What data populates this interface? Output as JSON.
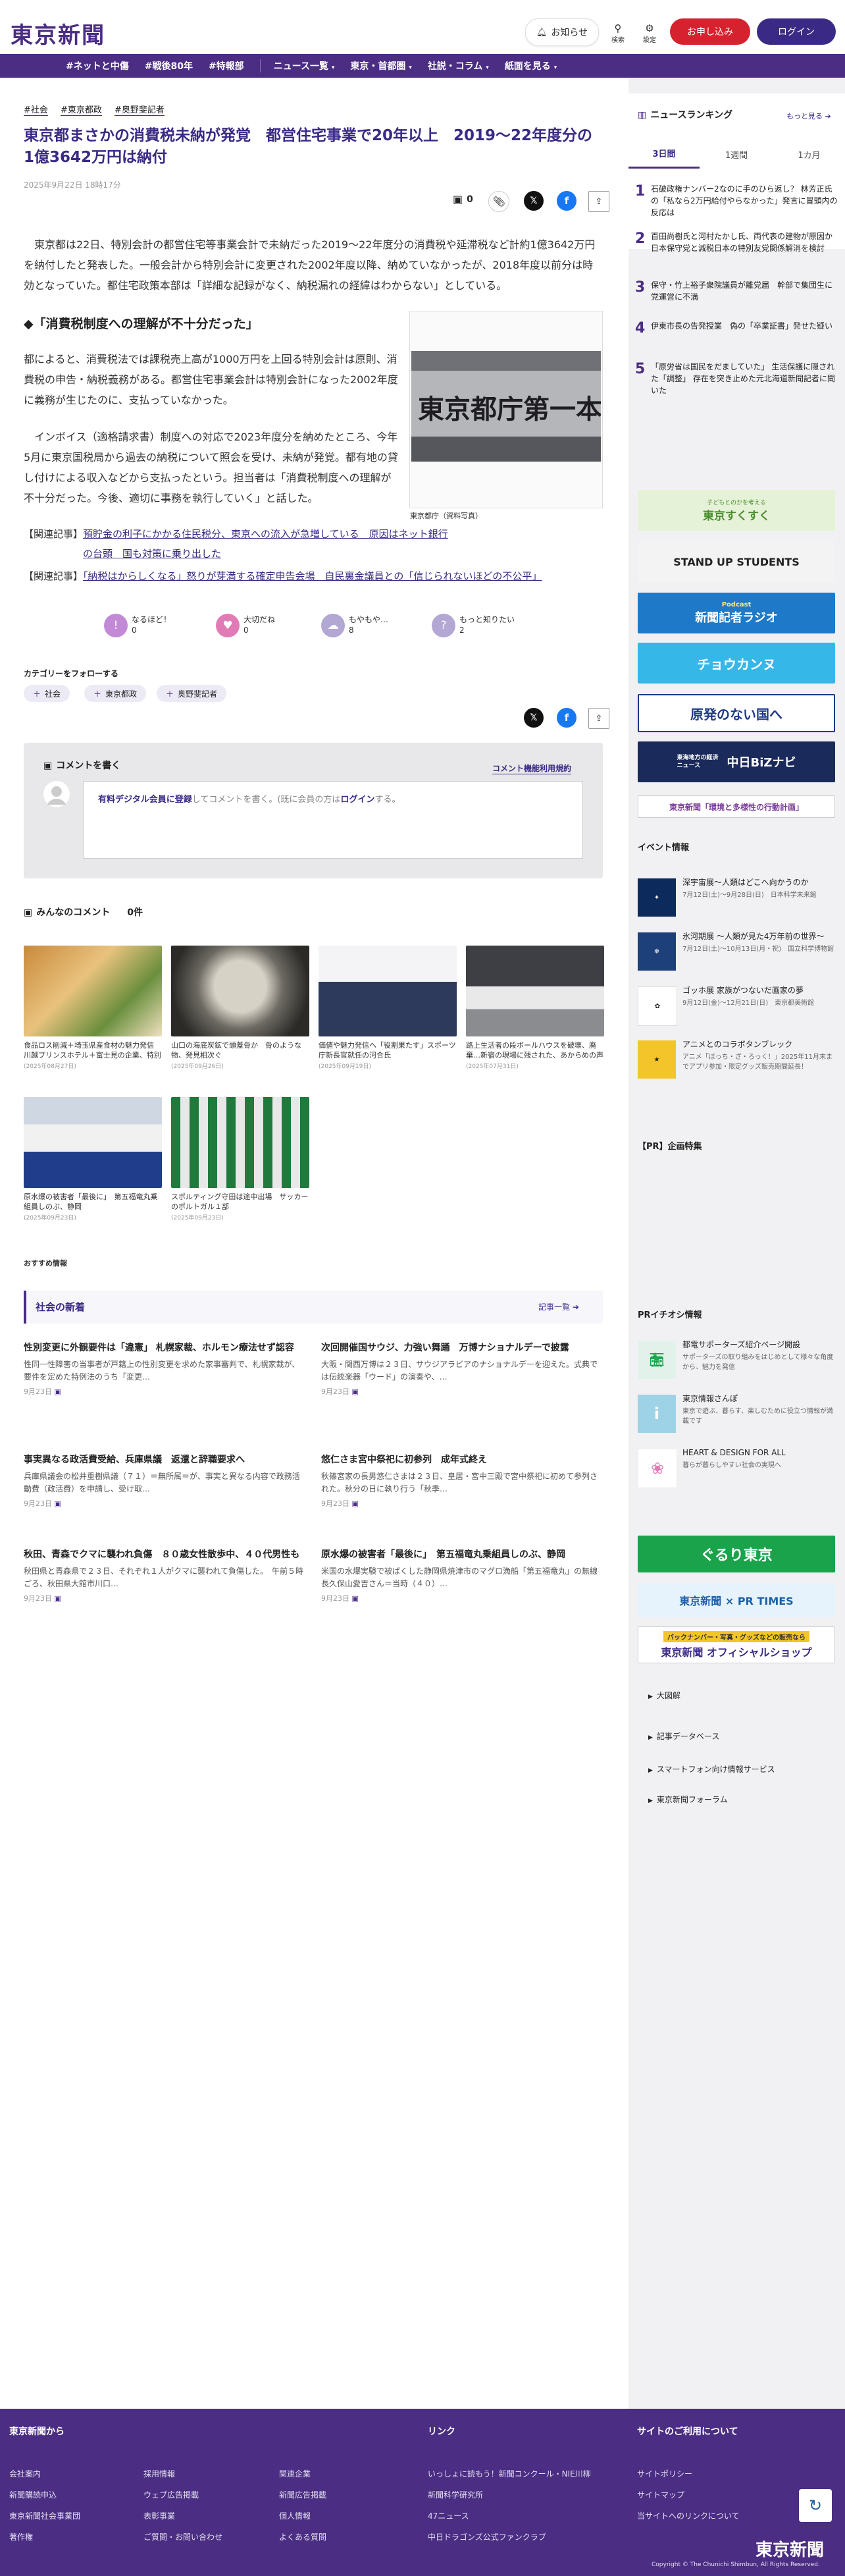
{
  "header": {
    "logo": "東京新聞",
    "notice_label": "お知らせ",
    "search_label": "検索",
    "settings_label": "設定",
    "subscribe_label": "お申し込み",
    "login_label": "ログイン"
  },
  "nav": {
    "items": [
      "#ネットと中傷",
      "#戦後80年",
      "#特報部",
      "ニュース一覧",
      "東京・首都圏",
      "社説・コラム",
      "紙面を見る"
    ]
  },
  "article": {
    "tags": [
      "#社会",
      "#東京都政",
      "#奥野斐記者"
    ],
    "title": "東京都まさかの消費税未納が発覚　都営住宅事業で20年以上　2019～22年度分の1億3642万円は納付",
    "date": "2025年9月22日 18時17分",
    "comment_count": "0",
    "lead": "東京都は22日、特別会計の都営住宅等事業会計で未納だった2019～22年度分の消費税や延滞税など計約1億3642万円を納付したと発表した。一般会計から特別会計に変更された2002年度以降、納めていなかったが、2018年度以前分は時効となっていた。都住宅政策本部は「詳細な記録がなく、納税漏れの経緯はわからない」としている。",
    "heading": "◆「消費税制度への理解が不十分だった」",
    "p1": "都によると、消費税法では課税売上高が1000万円を上回る特別会計は原則、消費税の申告・納税義務がある。都営住宅事業会計は特別会計になった2002年度に義務が生じたのに、支払っていなかった。",
    "p2": "インボイス（適格請求書）制度への対応で2023年度分を納めたところ、今年5月に東京国税局から過去の納税について照会を受け、未納が発覚。都有地の貸し付けによる収入などから支払ったという。担当者は「消費税制度への理解が不十分だった。今後、適切に事務を執行していく」と話した。",
    "photo_caption": "東京都庁（資料写真）",
    "photo_sign": "東京都庁第一本庁舎",
    "related_label": "【関連記事】",
    "related1": "預貯金の利子にかかる住民税分、東京への流入が急増している　原因はネット銀行の台頭　国も対策に乗り出した",
    "related2": "「納税はからしくなる」怒りが芽満する確定申告会場　自民裏金議員との「信じられないほどの不公平」",
    "reactions": [
      {
        "label": "なるほど！",
        "count": "0",
        "color": "#c28ad6",
        "icon": "lightbulb-icon"
      },
      {
        "label": "大切だね",
        "count": "0",
        "color": "#e07bb5",
        "icon": "heart-icon"
      },
      {
        "label": "もやもや…",
        "count": "8",
        "color": "#b3a7d4",
        "icon": "cloud-icon"
      },
      {
        "label": "もっと知りたい",
        "count": "2",
        "color": "#b3a7d4",
        "icon": "question-icon"
      }
    ],
    "follow_label": "カテゴリーをフォローする",
    "follow_tags": [
      "社会",
      "東京都政",
      "奥野斐記者"
    ]
  },
  "comments": {
    "write_label": "コメントを書く",
    "rules_link": "コメント機能利用規約",
    "prompt_link": "有料デジタル会員に登録",
    "prompt_mid": "してコメントを書く。(既に会員の方は",
    "prompt_login": "ログイン",
    "prompt_end": "する。",
    "all_label": "みんなのコメント",
    "all_count": "0件"
  },
  "thumbs": [
    {
      "caption": "食品ロス削減＋埼玉県産食材の魅力発信　川越プリンスホテル＋富士見の企業、特別メニュー…",
      "date": "(2025年08月27日)"
    },
    {
      "caption": "山口の海底炭鉱で頭蓋骨か　骨のような物、発見相次ぐ",
      "date": "(2025年09月26日)"
    },
    {
      "caption": "価値や魅力発信へ「役割果たす」スポーツ庁新長官就任の河合氏",
      "date": "(2025年09月19日)"
    },
    {
      "caption": "路上生活者の段ボールハウスを破壊、廃棄…新宿の現場に残された、あからめの声と「やり…",
      "date": "(2025年07月31日)"
    },
    {
      "caption": "原水爆の被害者「最後に」　第五福竜丸乗組員しのぶ、静岡",
      "date": "(2025年09月23日)"
    },
    {
      "caption": "スポルティング守田は途中出場　サッカーのポルトガル１部",
      "date": "(2025年09月23日)"
    }
  ],
  "recommend_label": "おすすめ情報",
  "society": {
    "title": "社会の新着",
    "more": "記事一覧",
    "items": [
      {
        "title": "性別変更に外観要件は「違憲」 札幌家裁、ホルモン療法せず認容",
        "summary": "性同一性障害の当事者が戸籍上の性別変更を求めた家事審判で、札幌家裁が、要件を定めた特例法のうち「変更…",
        "date": "9月23日"
      },
      {
        "title": "次回開催国サウジ、力強い舞踊　万博ナショナルデーで披露",
        "summary": "大阪・関西万博は２３日、サウジアラビアのナショナルデーを迎えた。式典では伝統楽器「ウード」の演奏や、…",
        "date": "9月23日"
      },
      {
        "title": "事実異なる政活費受給、兵庫県議　返還と辞職要求へ",
        "summary": "兵庫県議会の松井重樹県議（７１）＝無所属＝が、事実と異なる内容で政務活動費（政活費）を申請し、受け取…",
        "date": "9月23日"
      },
      {
        "title": "悠仁さま宮中祭祀に初参列　成年式終え",
        "summary": "秋篠宮家の長男悠仁さまは２３日、皇居・宮中三殿で宮中祭祀に初めて参列された。秋分の日に執り行う「秋季…",
        "date": "9月23日"
      },
      {
        "title": "秋田、青森でクマに襲われ負傷　８０歳女性散歩中、４０代男性も",
        "summary": "秋田県と青森県で２３日、それぞれ１人がクマに襲われて負傷した。　午前５時ごろ、秋田県大館市川口…",
        "date": "9月23日"
      },
      {
        "title": "原水爆の被害者「最後に」　第五福竜丸乗組員しのぶ、静岡",
        "summary": "米国の水爆実験で被ばくした静岡県焼津市のマグロ漁船「第五福竜丸」の無線長久保山愛吉さん＝当時（４０）…",
        "date": "9月23日"
      }
    ]
  },
  "sidebar": {
    "ranking_title": "ニュースランキング",
    "ranking_more": "もっと見る",
    "tabs": [
      "3日間",
      "1週間",
      "1カ月"
    ],
    "ranking": [
      {
        "num": "1",
        "text": "石破政権ナンバー2なのに手のひら返し？ 林芳正氏の「私なら2万円給付やらなかった」発言に冒頭内の反応は"
      },
      {
        "num": "2",
        "text": "百田尚樹氏と河村たかし氏、両代表の建物が原因か　日本保守党と減税日本の特別友党関係解消を検討"
      },
      {
        "num": "3",
        "text": "保守・竹上裕子衆院議員が離党届　幹部で集団生に党運営に不満"
      },
      {
        "num": "4",
        "text": "伊東市長の告発授業　偽の「卒業証書」発せた疑い"
      },
      {
        "num": "5",
        "text": "「原労省は国民をだましていた」 生活保護に隠された「調整」 存在を突き止めた元北海道新聞記者に聞いた"
      }
    ],
    "banners": [
      {
        "text": "東京すくすく",
        "sub": "子どもとのかを考える",
        "bg": "#e6f2d8",
        "fg": "#4b8f2f"
      },
      {
        "text": "STAND UP STUDENTS",
        "sub": "",
        "bg": "#f3f3f3",
        "fg": "#222"
      },
      {
        "text": "新聞記者ラジオ",
        "sub": "Podcast",
        "bg": "#1e7ac8",
        "fg": "#fff"
      },
      {
        "text": "チョウカンヌ",
        "sub": "",
        "bg": "#35b8e8",
        "fg": "#fff"
      },
      {
        "text": "原発のない国へ",
        "sub": "",
        "bg": "#fff",
        "fg": "#1d3a87"
      },
      {
        "text": "中日BiZナビ",
        "sub": "東海地方の経済ニュース",
        "bg": "#1a2a5a",
        "fg": "#fff"
      },
      {
        "text": "東京新聞「環境と多様性の行動計画」",
        "sub": "",
        "bg": "#fff",
        "fg": "#7a3d9a"
      }
    ],
    "events_title": "イベント情報",
    "events": [
      {
        "title": "深宇宙展〜人類はどこへ向かうのか",
        "sub": "7月12日(土)〜9月28日(日)　日本科学未来館",
        "bg": "#0c2a5c",
        "fg": "#fff",
        "icon": "space-icon"
      },
      {
        "title": "氷河期展 〜人類が見た4万年前の世界〜",
        "sub": "7月12日(土)〜10月13日(月・祝)　国立科学博物館",
        "bg": "#1d3f7a",
        "fg": "#fff",
        "icon": "glacier-icon"
      },
      {
        "title": "ゴッホ展 家族がつないだ画家の夢",
        "sub": "9月12日(金)〜12月21日(日)　東京都美術館",
        "bg": "#fff",
        "fg": "#222",
        "icon": "gogh-icon"
      },
      {
        "title": "アニメとのコラボタンブレック",
        "sub": "アニメ「ぼっち・ざ・ろっく！」2025年11月末までアプリ参加・限定グッズ販売期間延長！",
        "bg": "#f4c52a",
        "fg": "#222",
        "icon": "anime-icon"
      }
    ],
    "pr_title": "【PR】企画特集",
    "pr_event_title": "PRイチオシ情報",
    "pr_items": [
      {
        "title": "都電サポーターズ紹介ページ開設",
        "sub": "サポーターズの取り組みをはじめとして様々な角度から、魅力を発信",
        "bg": "#e2f2ea",
        "icon": "tram-icon"
      },
      {
        "title": "東京情報さんぽ",
        "sub": "東京で遊ぶ、暮らす、楽しむために役立つ情報が満載です",
        "bg": "#9ed2e6",
        "icon": "info-icon"
      },
      {
        "title": "HEART & DESIGN FOR ALL",
        "sub": "暮らが暮らしやすい社会の実現へ",
        "bg": "#fff",
        "icon": "flower-icon"
      }
    ],
    "bottom_banners": [
      {
        "text": "ぐるり東京",
        "bg": "#1aa34a",
        "fg": "#fff"
      },
      {
        "text": "東京新聞 × PR TIMES",
        "bg": "#e6f3fc",
        "fg": "#1d5fa8"
      },
      {
        "text": "東京新聞 オフィシャルショップ",
        "bg": "#fff",
        "fg": "#3b2a85"
      }
    ],
    "bottom_banner_note": "バックナンバー・写真・グッズなどの販売なら",
    "links": [
      "大図解",
      "記事データベース",
      "スマートフォン向け情報サービス",
      "東京新聞フォーラム"
    ]
  },
  "footer": {
    "col1_title": "東京新聞から",
    "col1": [
      "会社案内",
      "採用情報",
      "関連企業",
      "新聞購読申込",
      "ウェブ広告掲載",
      "新聞広告掲載",
      "東京新聞社会事業団",
      "表彰事業",
      "個人情報",
      "著作権",
      "ご質問・お問い合わせ",
      "よくある質問"
    ],
    "col2_title": "リンク",
    "col2": [
      "いっしょに読もう！新聞コンクール・NIE川柳",
      "新聞科学研究所",
      "47ニュース",
      "中日ドラゴンズ公式ファンクラブ"
    ],
    "col3_title": "サイトのご利用について",
    "col3": [
      "サイトポリシー",
      "サイトマップ",
      "当サイトへのリンクについて"
    ],
    "logo": "東京新聞",
    "copyright": "Copyright © The Chunichi Shimbun, All Rights Reserved."
  }
}
